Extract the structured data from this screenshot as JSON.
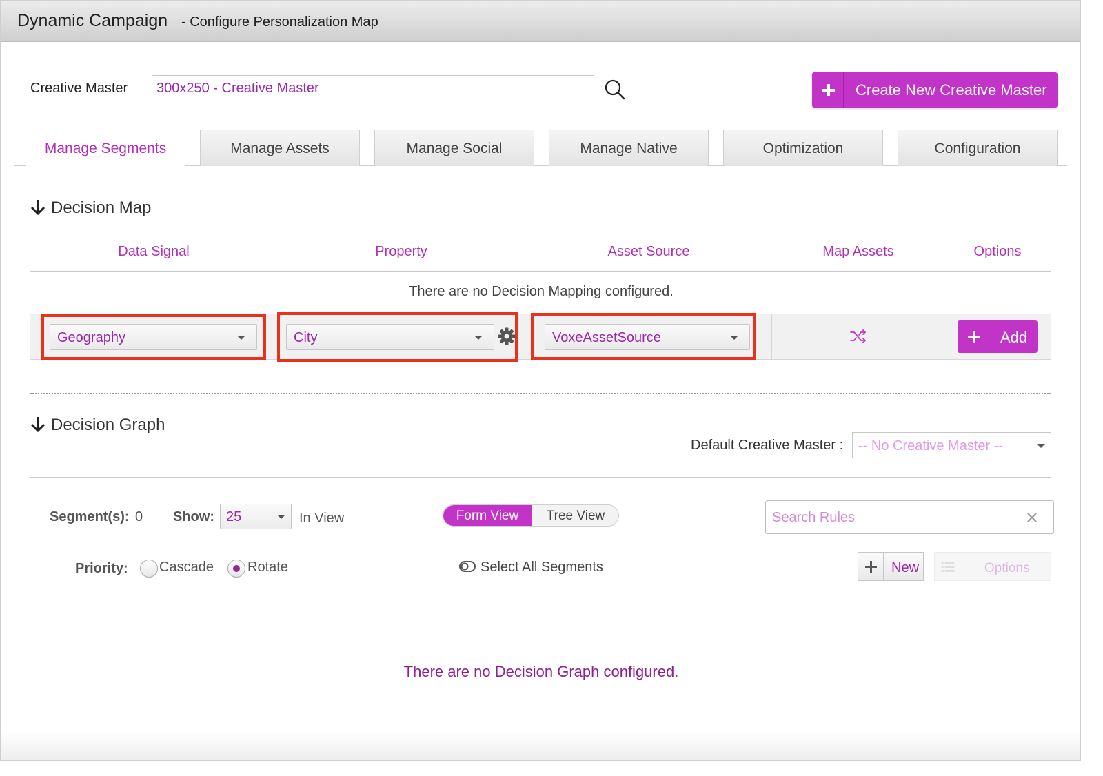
{
  "window": {
    "app_title": "Dynamic Campaign",
    "subtitle": "- Configure Personalization Map"
  },
  "creative_master": {
    "label": "Creative Master",
    "value": "300x250 - Creative Master",
    "create_button": "Create New Creative Master"
  },
  "tabs": [
    {
      "label": "Manage Segments",
      "active": true
    },
    {
      "label": "Manage Assets",
      "active": false
    },
    {
      "label": "Manage Social",
      "active": false
    },
    {
      "label": "Manage Native",
      "active": false
    },
    {
      "label": "Optimization",
      "active": false
    },
    {
      "label": "Configuration",
      "active": false
    }
  ],
  "decision_map": {
    "title": "Decision Map",
    "columns": [
      "Data Signal",
      "Property",
      "Asset Source",
      "Map Assets",
      "Options"
    ],
    "empty_message": "There are no Decision Mapping configured.",
    "row": {
      "data_signal": "Geography",
      "property": "City",
      "asset_source": "VoxeAssetSource",
      "add_button": "Add"
    }
  },
  "decision_graph": {
    "title": "Decision Graph",
    "default_master_label": "Default Creative Master :",
    "default_master_value": "-- No Creative Master --",
    "segments_label": "Segment(s):",
    "segments_count": "0",
    "show_label": "Show:",
    "show_value": "25",
    "in_view_label": "In View",
    "view_toggle": {
      "form": "Form View",
      "tree": "Tree View",
      "active": "form"
    },
    "search_placeholder": "Search Rules",
    "priority_label": "Priority:",
    "priority_options": [
      {
        "label": "Cascade",
        "checked": false
      },
      {
        "label": "Rotate",
        "checked": true
      }
    ],
    "select_all_label": "Select All Segments",
    "new_button": "New",
    "options_button": "Options",
    "empty_message": "There are no Decision Graph configured."
  },
  "colors": {
    "accent": "#c233c8",
    "accent_text": "#b22fb8",
    "highlight_box": "#e8321e"
  }
}
